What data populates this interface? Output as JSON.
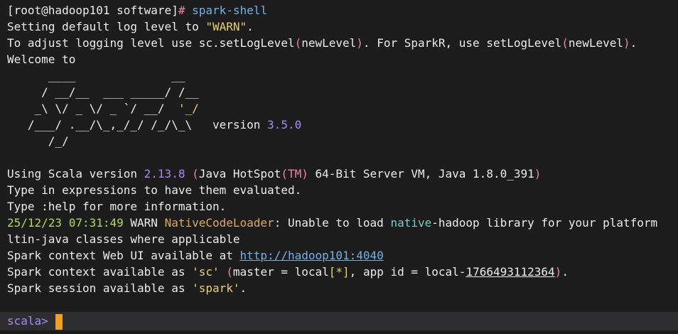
{
  "prompt": {
    "user_host": "[root@hadoop101 software]",
    "symbol": "#",
    "command": "spark-shell"
  },
  "log_level": {
    "prefix": "Setting default log level to ",
    "value": "\"WARN\"",
    "suffix": "."
  },
  "adjust": {
    "p1": "To adjust logging level use sc.setLogLevel",
    "paren_open": "(",
    "arg1": "newLevel",
    "paren_close": ")",
    "p2": ". For SparkR, use setLogLevel",
    "arg2": "newLevel",
    "p3": "."
  },
  "welcome": "Welcome to",
  "banner": {
    "line1": "      ____              __",
    "line2": "     / __/__  ___ _____/ /__",
    "line3a": "    _\\ \\/ _ \\/ _ `/ __/  ",
    "line3b": "'_/",
    "line4a": "   /___/ .__/\\_,_/_/ /_/\\_\\   version ",
    "version": "3.5.0",
    "line5": "      /_/"
  },
  "scala_line": {
    "p1": "Using Scala version ",
    "version": "2.13.8",
    "p2": " ",
    "paren_open": "(",
    "p3": "Java HotSpot",
    "tm": "(TM)",
    "p4": " 64-Bit Server VM, Java 1.8.0_391",
    "paren_close": ")"
  },
  "type_expressions": "Type in expressions to have them evaluated.",
  "type_help": "Type :help for more information.",
  "warn": {
    "timestamp": "25/12/23 07:31:49",
    "level": " WARN ",
    "cls": "NativeCodeLoader",
    "msg1": ": Unable to load ",
    "native": "native",
    "msg2": "-hadoop library for your platform"
  },
  "builtin": "ltin-java classes where applicable",
  "webui": {
    "prefix": "Spark context Web UI available at ",
    "url": "http://hadoop101:4040"
  },
  "context": {
    "p1": "Spark context available as ",
    "sc": "'sc'",
    "p2": " ",
    "paren_open": "(",
    "p3": "master = local",
    "bracket": "[*]",
    "p4": ", app id = local-",
    "appid": "1766493112364",
    "paren_close": ")",
    "p5": "."
  },
  "session": {
    "p1": "Spark session available as ",
    "spark": "'spark'",
    "p2": "."
  },
  "scala_prompt": "scala>"
}
